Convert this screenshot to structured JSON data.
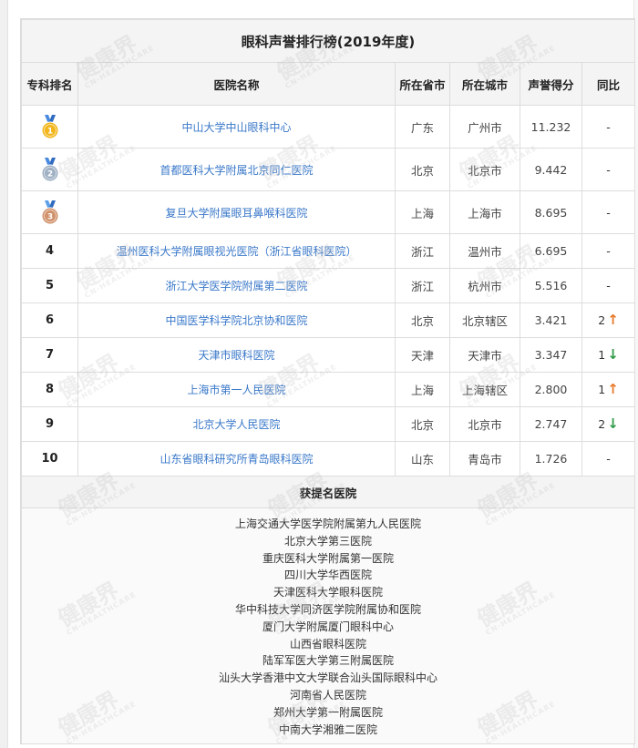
{
  "title": "眼科声誉排行榜(2019年度)",
  "columns": [
    "专科排名",
    "医院名称",
    "所在省市",
    "所在城市",
    "声誉得分",
    "同比"
  ],
  "rows": [
    {
      "rank": "",
      "medal": "gold",
      "medal_num": "1",
      "hospital": "中山大学中山眼科中心",
      "province": "广东",
      "city": "广州市",
      "score": "11.232",
      "yoy": "-",
      "trend": ""
    },
    {
      "rank": "",
      "medal": "silver",
      "medal_num": "2",
      "hospital": "首都医科大学附属北京同仁医院",
      "province": "北京",
      "city": "北京市",
      "score": "9.442",
      "yoy": "-",
      "trend": ""
    },
    {
      "rank": "",
      "medal": "bronze",
      "medal_num": "3",
      "hospital": "复旦大学附属眼耳鼻喉科医院",
      "province": "上海",
      "city": "上海市",
      "score": "8.695",
      "yoy": "-",
      "trend": ""
    },
    {
      "rank": "4",
      "medal": "",
      "medal_num": "",
      "hospital": "温州医科大学附属眼视光医院（浙江省眼科医院）",
      "province": "浙江",
      "city": "温州市",
      "score": "6.695",
      "yoy": "-",
      "trend": ""
    },
    {
      "rank": "5",
      "medal": "",
      "medal_num": "",
      "hospital": "浙江大学医学院附属第二医院",
      "province": "浙江",
      "city": "杭州市",
      "score": "5.516",
      "yoy": "-",
      "trend": ""
    },
    {
      "rank": "6",
      "medal": "",
      "medal_num": "",
      "hospital": "中国医学科学院北京协和医院",
      "province": "北京",
      "city": "北京辖区",
      "score": "3.421",
      "yoy": "2",
      "trend": "up"
    },
    {
      "rank": "7",
      "medal": "",
      "medal_num": "",
      "hospital": "天津市眼科医院",
      "province": "天津",
      "city": "天津市",
      "score": "3.347",
      "yoy": "1",
      "trend": "down"
    },
    {
      "rank": "8",
      "medal": "",
      "medal_num": "",
      "hospital": "上海市第一人民医院",
      "province": "上海",
      "city": "上海辖区",
      "score": "2.800",
      "yoy": "1",
      "trend": "up"
    },
    {
      "rank": "9",
      "medal": "",
      "medal_num": "",
      "hospital": "北京大学人民医院",
      "province": "北京",
      "city": "北京市",
      "score": "2.747",
      "yoy": "2",
      "trend": "down"
    },
    {
      "rank": "10",
      "medal": "",
      "medal_num": "",
      "hospital": "山东省眼科研究所青岛眼科医院",
      "province": "山东",
      "city": "青岛市",
      "score": "1.726",
      "yoy": "-",
      "trend": ""
    }
  ],
  "nominated_title": "获提名医院",
  "nominated": [
    "上海交通大学医学院附属第九人民医院",
    "北京大学第三医院",
    "重庆医科大学附属第一医院",
    "四川大学华西医院",
    "天津医科大学眼科医院",
    "华中科技大学同济医学院附属协和医院",
    "厦门大学附属厦门眼科中心",
    "山西省眼科医院",
    "陆军军医大学第三附属医院",
    "汕头大学香港中文大学联合汕头国际眼科中心",
    "河南省人民医院",
    "郑州大学第一附属医院",
    "中南大学湘雅二医院"
  ],
  "watermark": {
    "brand": "健康界",
    "sub": "CN-HEALTHCARE"
  },
  "colors": {
    "link": "#3a78c9",
    "up_arrow": "#e8792a",
    "down_arrow": "#2f9a48",
    "gold": "#f2b61c",
    "silver": "#9fb0c4",
    "bronze": "#d0906a"
  }
}
